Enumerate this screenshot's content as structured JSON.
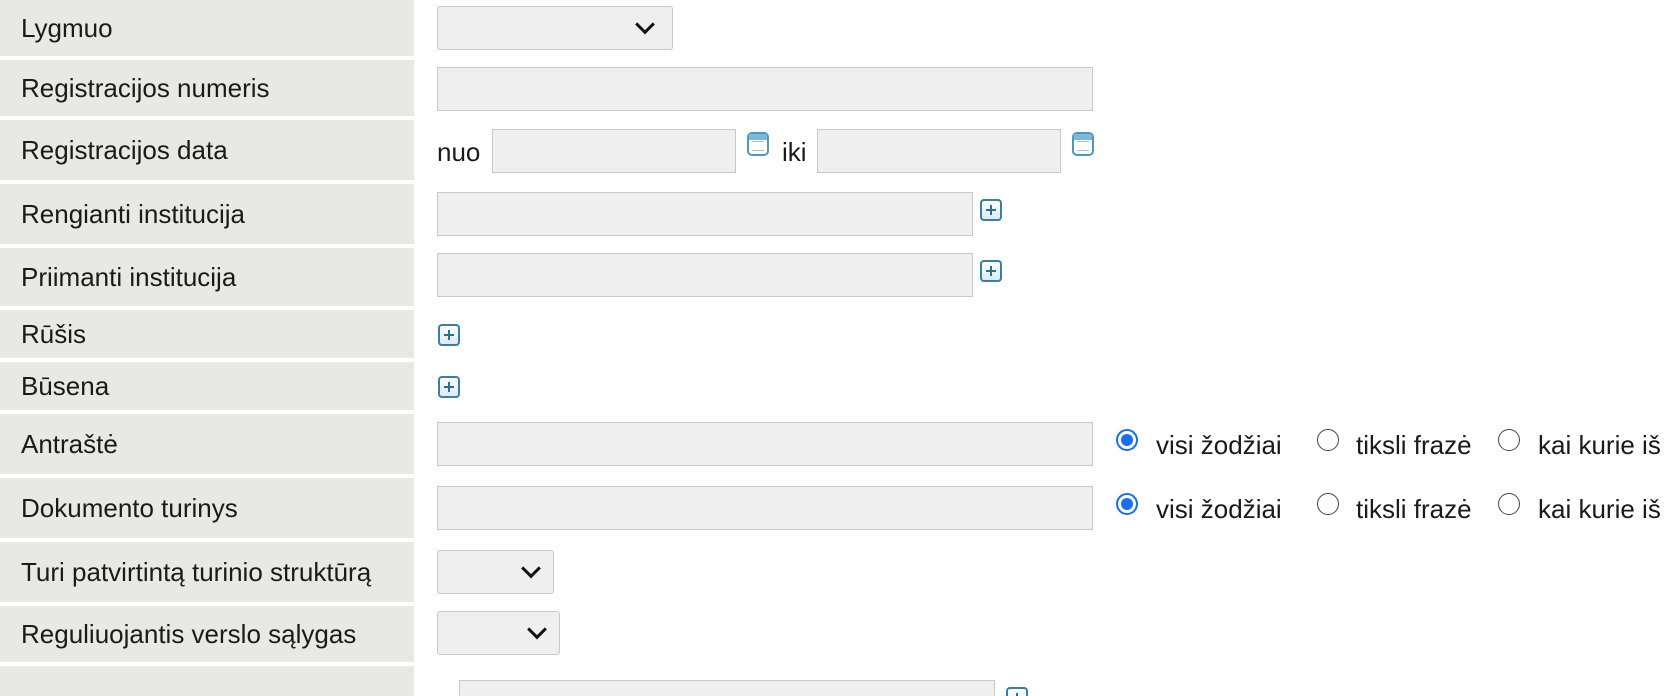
{
  "fields": {
    "lygmuo": {
      "label": "Lygmuo",
      "value": ""
    },
    "registracijos_numeris": {
      "label": "Registracijos numeris",
      "value": ""
    },
    "registracijos_data": {
      "label": "Registracijos data",
      "from_label": "nuo",
      "to_label": "iki",
      "from_value": "",
      "to_value": ""
    },
    "rengianti_institucija": {
      "label": "Rengianti institucija",
      "value": ""
    },
    "priimanti_institucija": {
      "label": "Priimanti institucija",
      "value": ""
    },
    "rusis": {
      "label": "Rūšis"
    },
    "busena": {
      "label": "Būsena"
    },
    "antraste": {
      "label": "Antraštė",
      "value": "",
      "options": [
        "visi žodžiai",
        "tiksli frazė",
        "kai kurie iš"
      ],
      "selected": "visi žodžiai"
    },
    "dokumento_turinys": {
      "label": "Dokumento turinys",
      "value": "",
      "options": [
        "visi žodžiai",
        "tiksli frazė",
        "kai kurie iš"
      ],
      "selected": "visi žodžiai"
    },
    "turi_struktura": {
      "label": "Turi patvirtintą turinio struktūrą",
      "value": ""
    },
    "reguliuojantis": {
      "label": "Reguliuojantis verslo sąlygas",
      "value": ""
    },
    "extra": {
      "value": ""
    }
  },
  "icons": {
    "add": "plus-square-icon",
    "calendar": "calendar-icon"
  },
  "colors": {
    "label_bg": "#e8e8e4",
    "input_bg": "#efefef",
    "radio_selected": "#1a6ef5",
    "icon_accent": "#3a7fa3"
  }
}
